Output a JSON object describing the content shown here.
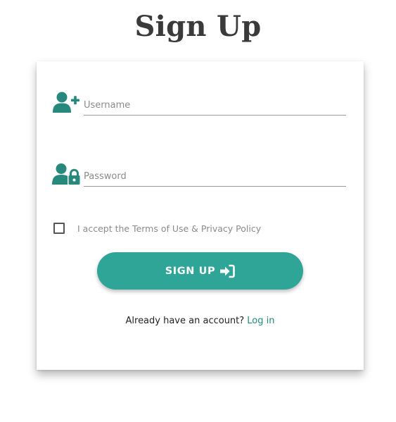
{
  "page": {
    "title": "Sign Up"
  },
  "form": {
    "username": {
      "placeholder": "Username",
      "value": "",
      "icon": "user-plus-icon"
    },
    "password": {
      "placeholder": "Password",
      "value": "",
      "icon": "user-lock-icon"
    },
    "terms": {
      "label": "I accept the Terms of Use & Privacy Policy",
      "checked": false
    },
    "submit": {
      "label": "SIGN UP",
      "icon": "sign-in-icon"
    },
    "login_prompt": {
      "text": "Already have an account?",
      "link_label": "Log in"
    }
  },
  "colors": {
    "accent": "#2ea596",
    "link": "#1f8a7c",
    "icon": "#26897c",
    "title": "#3a3a3a"
  }
}
